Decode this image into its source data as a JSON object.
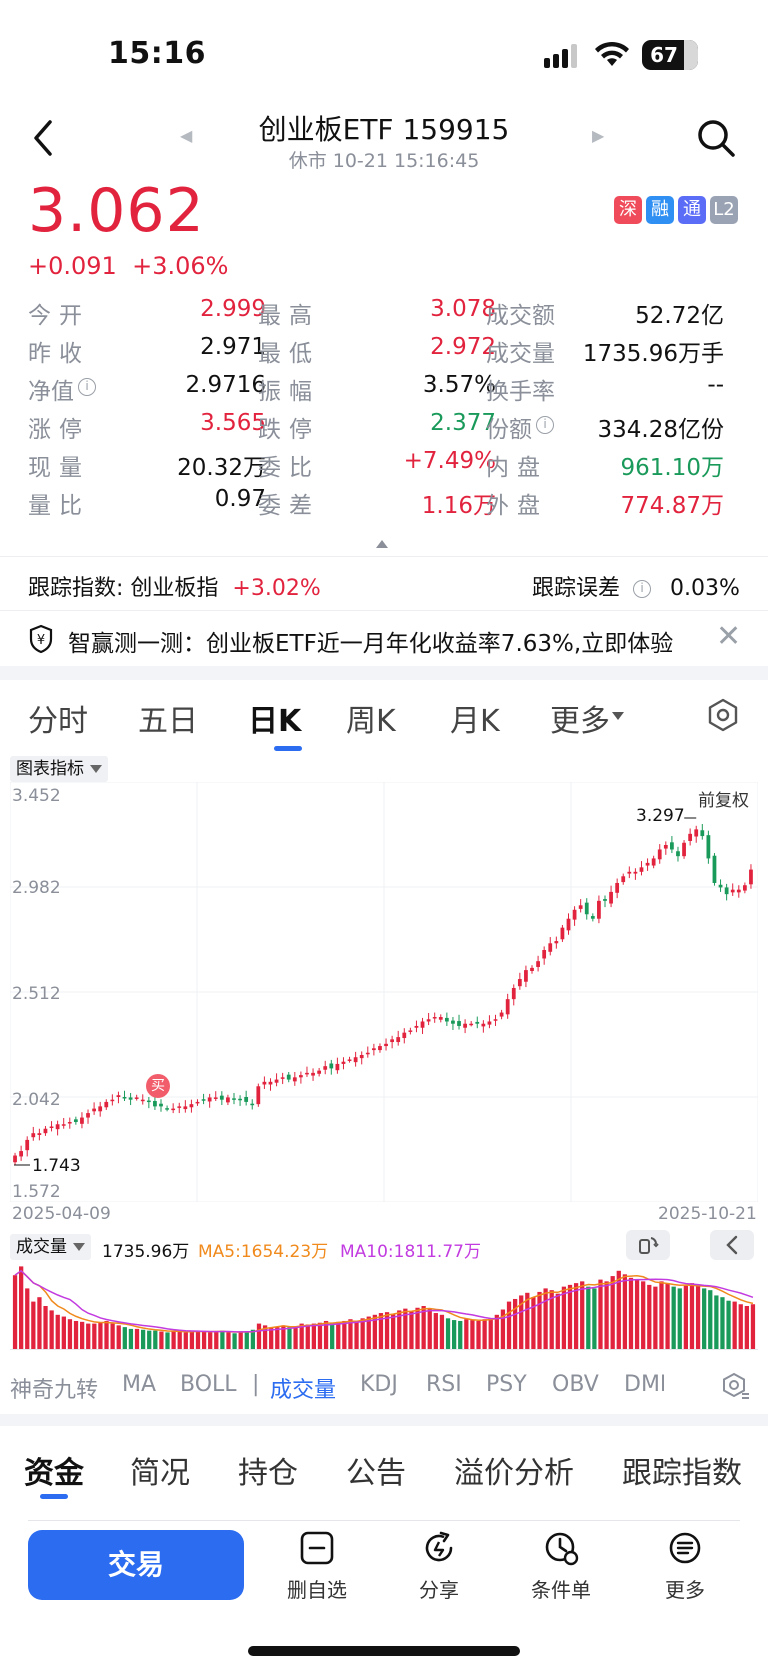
{
  "status_bar": {
    "time": "15:16",
    "battery": "67"
  },
  "header": {
    "title": "创业板ETF 159915",
    "subtitle": "休市 10-21 15:16:45"
  },
  "price": {
    "last": "3.062",
    "change": "+0.091",
    "change_pct": "+3.06%"
  },
  "badges": [
    {
      "label": "深",
      "color": "#ef4b5b"
    },
    {
      "label": "融",
      "color": "#2f8ff2"
    },
    {
      "label": "通",
      "color": "#5b6cf6"
    },
    {
      "label": "L2",
      "color": "#9aa3b4"
    }
  ],
  "quote": {
    "open_label": "今开",
    "open": "2.999",
    "high_label": "最高",
    "high": "3.078",
    "turnover_label": "成交额",
    "turnover": "52.72亿",
    "prev_close_label": "昨收",
    "prev_close": "2.971",
    "low_label": "最低",
    "low": "2.972",
    "volume_label": "成交量",
    "volume": "1735.96万手",
    "nav_label": "净值",
    "nav": "2.9716",
    "amplitude_label": "振幅",
    "amplitude": "3.57%",
    "turnover_rate_label": "换手率",
    "turnover_rate": "--",
    "limit_up_label": "涨停",
    "limit_up": "3.565",
    "limit_down_label": "跌停",
    "limit_down": "2.377",
    "shares_label": "份额",
    "shares": "334.28亿份",
    "current_vol_label": "现量",
    "current_vol": "20.32万",
    "order_ratio_label": "委比",
    "order_ratio": "+7.49%",
    "inner_label": "内盘",
    "inner": "961.10万",
    "vol_ratio_label": "量比",
    "vol_ratio": "0.97",
    "order_diff_label": "委差",
    "order_diff": "1.16万",
    "outer_label": "外盘",
    "outer": "774.87万"
  },
  "tracking": {
    "index_label": "跟踪指数: 创业板指",
    "index_change": "+3.02%",
    "error_label": "跟踪误差",
    "error_value": "0.03%"
  },
  "promo": {
    "text": "智赢测一测：创业板ETF近一月年化收益率7.63%,立即体验"
  },
  "period_tabs": [
    "分时",
    "五日",
    "日K",
    "周K",
    "月K",
    "更多"
  ],
  "chart_controls": {
    "indicator_button": "图表指标",
    "adjust_label": "前复权",
    "volume_label": "成交量",
    "volume_value": "1735.96万",
    "ma5": "MA5:1654.23万",
    "ma10": "MA10:1811.77万",
    "buy_marker": "买"
  },
  "chart_data": {
    "type": "candlestick",
    "y_ticks": [
      "3.452",
      "2.982",
      "2.512",
      "2.042",
      "1.572"
    ],
    "ylim": [
      1.572,
      3.452
    ],
    "x_start": "2025-04-09",
    "x_end": "2025-10-21",
    "max_label": "3.297",
    "min_label": "1.743",
    "close_trend": [
      1.78,
      1.8,
      1.85,
      1.88,
      1.88,
      1.9,
      1.91,
      1.92,
      1.92,
      1.93,
      1.93,
      1.95,
      1.97,
      1.99,
      2.0,
      2.02,
      2.03,
      2.05,
      2.04,
      2.03,
      2.04,
      2.03,
      2.02,
      2.0,
      2.0,
      1.99,
      1.99,
      2.0,
      2.0,
      2.01,
      2.02,
      2.03,
      2.04,
      2.04,
      2.03,
      2.04,
      2.03,
      2.03,
      2.02,
      2.01,
      2.09,
      2.11,
      2.11,
      2.12,
      2.13,
      2.12,
      2.13,
      2.14,
      2.15,
      2.15,
      2.16,
      2.18,
      2.17,
      2.19,
      2.2,
      2.21,
      2.22,
      2.23,
      2.24,
      2.26,
      2.27,
      2.28,
      2.3,
      2.31,
      2.33,
      2.34,
      2.36,
      2.38,
      2.39,
      2.4,
      2.4,
      2.38,
      2.37,
      2.36,
      2.37,
      2.37,
      2.37,
      2.37,
      2.38,
      2.39,
      2.42,
      2.48,
      2.53,
      2.57,
      2.61,
      2.62,
      2.65,
      2.7,
      2.73,
      2.74,
      2.8,
      2.84,
      2.88,
      2.9,
      2.86,
      2.84,
      2.92,
      2.92,
      2.96,
      3.0,
      3.03,
      3.05,
      3.05,
      3.07,
      3.09,
      3.11,
      3.15,
      3.17,
      3.15,
      3.12,
      3.18,
      3.22,
      3.24,
      3.21,
      3.11,
      3.0,
      2.98,
      2.95,
      2.97,
      2.97,
      2.99,
      3.06
    ],
    "volume_trend": [
      0.85,
      0.95,
      0.7,
      0.55,
      0.6,
      0.5,
      0.45,
      0.4,
      0.38,
      0.35,
      0.33,
      0.32,
      0.3,
      0.3,
      0.31,
      0.33,
      0.3,
      0.28,
      0.26,
      0.24,
      0.24,
      0.23,
      0.22,
      0.22,
      0.21,
      0.2,
      0.22,
      0.21,
      0.2,
      0.21,
      0.22,
      0.21,
      0.2,
      0.21,
      0.22,
      0.2,
      0.19,
      0.2,
      0.21,
      0.23,
      0.3,
      0.28,
      0.25,
      0.26,
      0.28,
      0.26,
      0.27,
      0.3,
      0.29,
      0.3,
      0.31,
      0.33,
      0.3,
      0.32,
      0.33,
      0.35,
      0.33,
      0.36,
      0.38,
      0.4,
      0.42,
      0.43,
      0.41,
      0.45,
      0.47,
      0.44,
      0.48,
      0.5,
      0.47,
      0.42,
      0.4,
      0.36,
      0.34,
      0.33,
      0.35,
      0.34,
      0.33,
      0.35,
      0.36,
      0.4,
      0.46,
      0.55,
      0.58,
      0.62,
      0.65,
      0.6,
      0.66,
      0.7,
      0.68,
      0.64,
      0.72,
      0.74,
      0.76,
      0.78,
      0.72,
      0.7,
      0.8,
      0.78,
      0.84,
      0.9,
      0.86,
      0.82,
      0.8,
      0.78,
      0.74,
      0.72,
      0.78,
      0.76,
      0.72,
      0.7,
      0.73,
      0.76,
      0.74,
      0.7,
      0.68,
      0.62,
      0.6,
      0.56,
      0.55,
      0.52,
      0.5,
      0.52
    ]
  },
  "indicator_tabs": [
    "神奇九转",
    "MA",
    "BOLL",
    "|",
    "成交量",
    "KDJ",
    "RSI",
    "PSY",
    "OBV",
    "DMI"
  ],
  "bottom_tabs": [
    "资金",
    "简况",
    "持仓",
    "公告",
    "溢价分析",
    "跟踪指数"
  ],
  "toolbar": {
    "trade": "交易",
    "remove_watch": "删自选",
    "share": "分享",
    "condition_order": "条件单",
    "more": "更多"
  }
}
